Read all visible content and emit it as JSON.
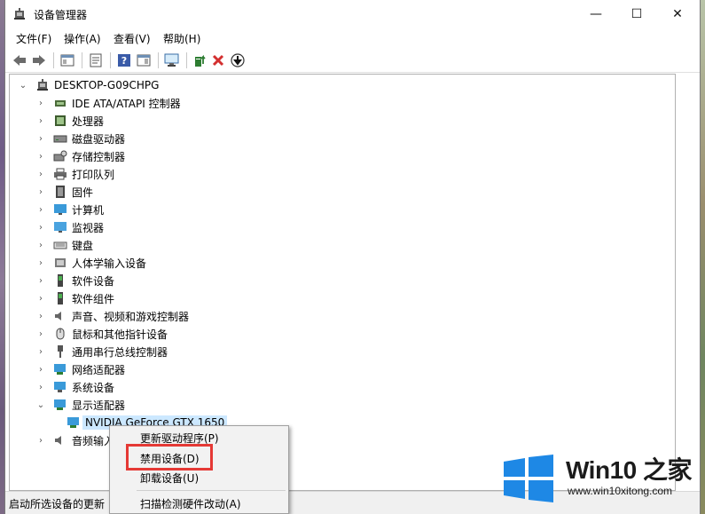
{
  "window": {
    "title": "设备管理器",
    "minimize": "—",
    "maximize": "☐",
    "close": "✕"
  },
  "menubar": {
    "items": [
      "文件(F)",
      "操作(A)",
      "查看(V)",
      "帮助(H)"
    ]
  },
  "toolbar": {
    "back_icon": "arrow-left-icon",
    "forward_icon": "arrow-right-icon"
  },
  "tree": {
    "root": "DESKTOP-G09CHPG",
    "categories": [
      "IDE ATA/ATAPI 控制器",
      "处理器",
      "磁盘驱动器",
      "存储控制器",
      "打印队列",
      "固件",
      "计算机",
      "监视器",
      "键盘",
      "人体学输入设备",
      "软件设备",
      "软件组件",
      "声音、视频和游戏控制器",
      "鼠标和其他指针设备",
      "通用串行总线控制器",
      "网络适配器",
      "系统设备",
      "显示适配器"
    ],
    "selected_device": "NVIDIA GeForce GTX 1650",
    "after_category": "音频输入"
  },
  "context_menu": {
    "items": [
      "更新驱动程序(P)",
      "禁用设备(D)",
      "卸载设备(U)",
      "扫描检测硬件改动(A)"
    ]
  },
  "status": {
    "text": "启动所选设备的更新"
  },
  "watermark": {
    "title": "Win10 之家",
    "url": "www.win10xitong.com",
    "brand_color": "#1e88e5"
  },
  "highlight_color": "#e53935"
}
